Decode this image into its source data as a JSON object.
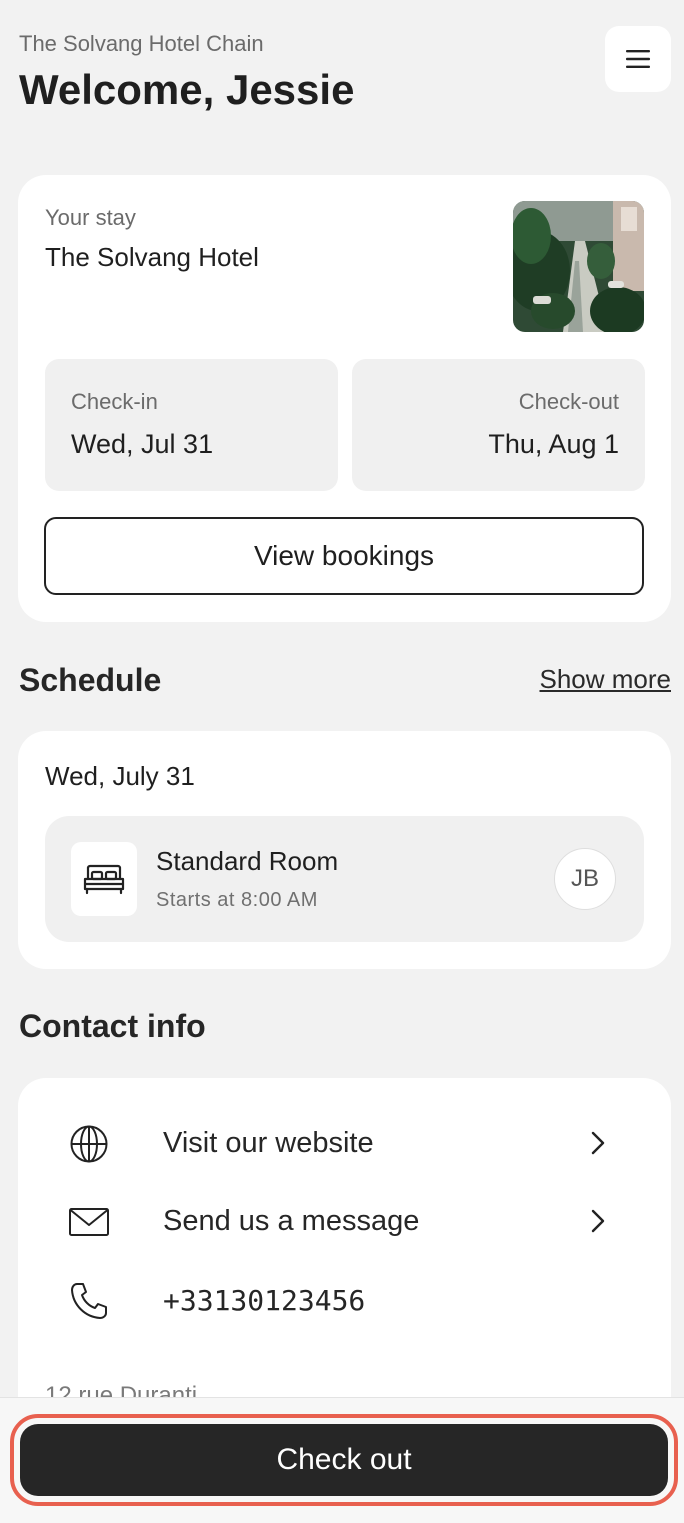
{
  "header": {
    "chain_name": "The Solvang Hotel Chain",
    "welcome": "Welcome, Jessie",
    "menu_icon": "hamburger-menu-icon"
  },
  "stay": {
    "label": "Your stay",
    "hotel_name": "The Solvang Hotel",
    "check_in": {
      "label": "Check-in",
      "value": "Wed, Jul 31"
    },
    "check_out": {
      "label": "Check-out",
      "value": "Thu, Aug 1"
    },
    "view_bookings_label": "View bookings"
  },
  "schedule": {
    "title": "Schedule",
    "show_more_label": "Show more",
    "date": "Wed, July 31",
    "item": {
      "icon": "bed-icon",
      "name": "Standard Room",
      "time": "Starts at 8:00 AM",
      "avatar_initials": "JB"
    }
  },
  "contact": {
    "title": "Contact info",
    "website_label": "Visit our website",
    "message_label": "Send us a message",
    "phone": "+33130123456",
    "address_partial": "12 rue Duranti"
  },
  "footer": {
    "checkout_label": "Check out"
  },
  "colors": {
    "background": "#f2f2f2",
    "card": "#ffffff",
    "primary_button": "#262626",
    "focus_outline": "#e8604f"
  }
}
